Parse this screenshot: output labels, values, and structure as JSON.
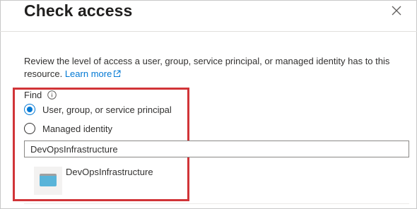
{
  "header": {
    "title": "Check access",
    "close_icon": "close-icon"
  },
  "description": {
    "text": "Review the level of access a user, group, service principal, or managed identity has to this resource.",
    "link_label": "Learn more",
    "link_icon": "external-link-icon"
  },
  "find": {
    "label": "Find",
    "info_icon": "info-icon",
    "options": [
      {
        "label": "User, group, or service principal",
        "selected": true
      },
      {
        "label": "Managed identity",
        "selected": false
      }
    ],
    "search_value": "DevOpsInfrastructure"
  },
  "results": [
    {
      "name": "DevOpsInfrastructure",
      "icon": "app-icon"
    }
  ],
  "colors": {
    "accent": "#0078d4",
    "highlight": "#d13438"
  }
}
